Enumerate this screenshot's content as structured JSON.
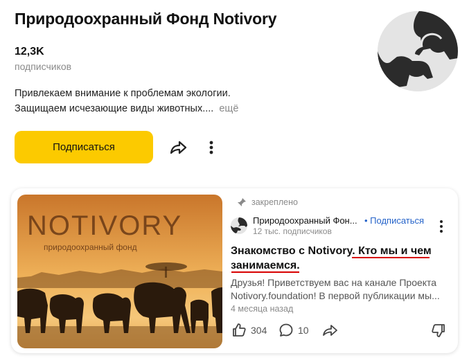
{
  "channel": {
    "title": "Природоохранный Фонд Notivory",
    "subscribers_count": "12,3K",
    "subscribers_label": "подписчиков",
    "description_line1": "Привлекаем внимание к проблемам экологии.",
    "description_line2": "Защищаем исчезающие виды животных....",
    "more_label": "ещё",
    "subscribe_label": "Подписаться"
  },
  "post": {
    "pinned_label": "закреплено",
    "channel_name": "Природоохранный Фон...",
    "subscribe_link": "• Подписаться",
    "channel_subscribers": "12 тыс. подписчиков",
    "title_part1": "Знакомство с Notivory.",
    "title_part2": "Кто мы и чем",
    "title_part3": "занимаемся.",
    "excerpt": "Друзья! Приветствуем вас на канале Проекта Notivory.foundation! В первой публикации мы...",
    "age": "4 месяца назад",
    "thumbnail_logo_text": "NOTIVORY",
    "thumbnail_subtitle": "природоохранный фонд",
    "likes": "304",
    "comments": "10"
  },
  "colors": {
    "accent_yellow": "#fcca00",
    "link_blue": "#2563c9",
    "annotation_red": "#d80000"
  },
  "icons": [
    "share-icon",
    "more-vertical-icon",
    "pin-icon",
    "like-icon",
    "comment-icon",
    "repost-icon",
    "dislike-icon"
  ]
}
